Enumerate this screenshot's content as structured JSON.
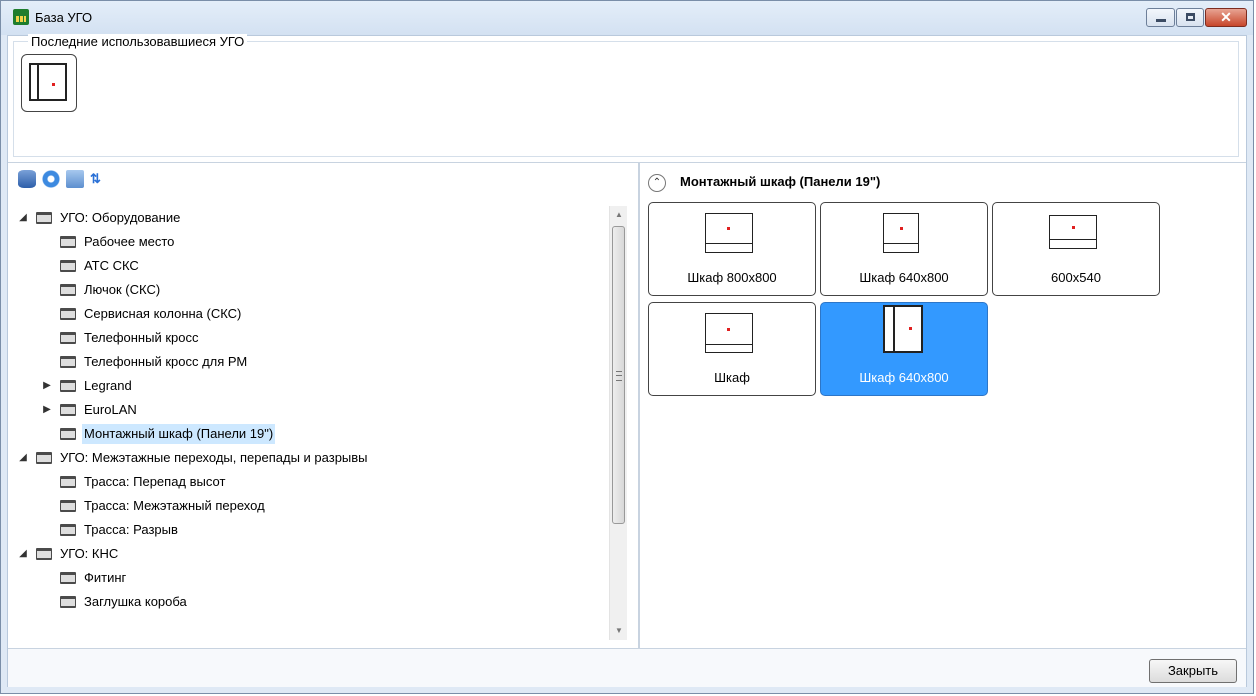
{
  "window": {
    "title": "База УГО"
  },
  "recent": {
    "label": "Последние использовавшиеся УГО"
  },
  "tree": {
    "items": [
      {
        "label": "УГО: Оборудование",
        "expanded": true
      },
      {
        "label": "Рабочее место"
      },
      {
        "label": "АТС СКС"
      },
      {
        "label": "Лючок (СКС)"
      },
      {
        "label": "Сервисная колонна (СКС)"
      },
      {
        "label": "Телефонный кросс"
      },
      {
        "label": "Телефонный кросс для РМ"
      },
      {
        "label": "Legrand",
        "expandable": true
      },
      {
        "label": "EuroLAN",
        "expandable": true
      },
      {
        "label": "Монтажный шкаф (Панели 19\")",
        "selected": true
      },
      {
        "label": "УГО: Межэтажные переходы, перепады и разрывы",
        "expanded": true
      },
      {
        "label": "Трасса: Перепад высот"
      },
      {
        "label": "Трасса: Межэтажный переход"
      },
      {
        "label": "Трасса: Разрыв"
      },
      {
        "label": "УГО: КНС",
        "expanded": true
      },
      {
        "label": "Фитинг"
      },
      {
        "label": "Заглушка короба"
      }
    ]
  },
  "group": {
    "title": "Монтажный шкаф (Панели 19\")",
    "tiles": [
      {
        "label": "Шкаф 800x800"
      },
      {
        "label": "Шкаф 640x800"
      },
      {
        "label": "600x540"
      },
      {
        "label": "Шкаф"
      },
      {
        "label": "Шкаф 640x800",
        "selected": true
      }
    ]
  },
  "footer": {
    "close_label": "Закрыть"
  },
  "icons": {
    "app": "app-icon",
    "toolbar": [
      "database-icon",
      "refresh-icon",
      "screen-refresh-icon",
      "sort-icon"
    ],
    "tree": "folder-icon",
    "collapse": "chevron-up-icon"
  },
  "colors": {
    "selection": "#3399ff",
    "tree_selection": "#cde8ff",
    "window_border": "#7a8ea8"
  }
}
